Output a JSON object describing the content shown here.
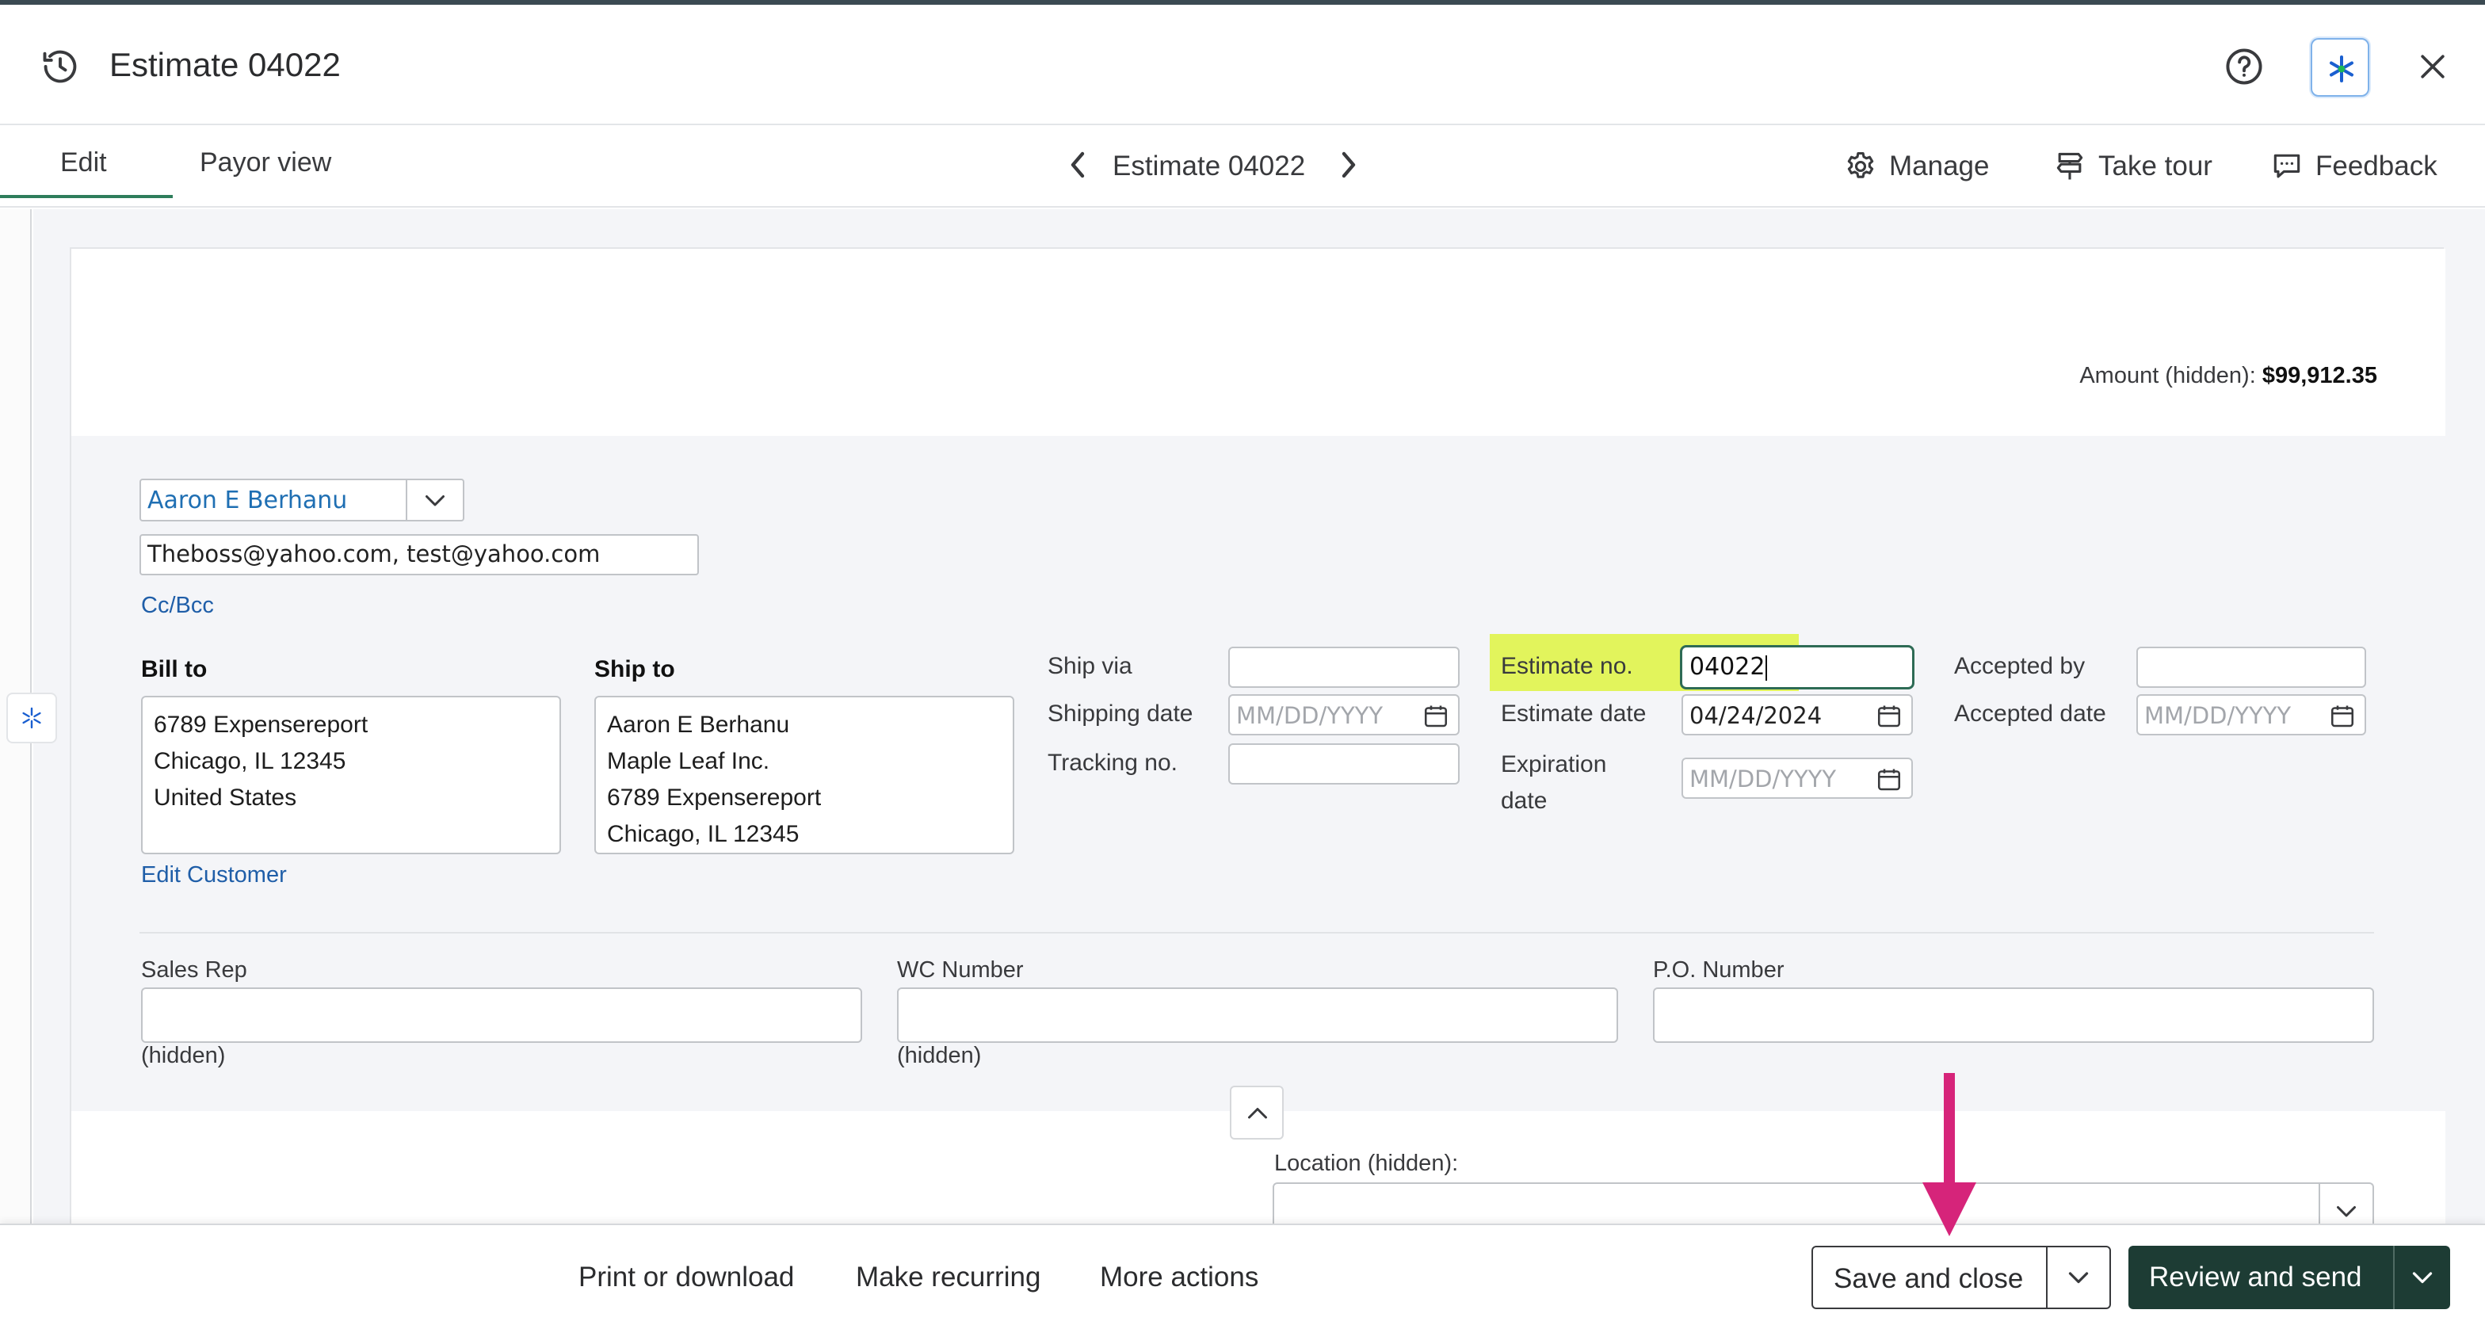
{
  "header": {
    "title": "Estimate 04022",
    "history_icon": "history-icon",
    "help_icon": "help-icon",
    "ai_icon": "sparkle-icon",
    "close_icon": "close-icon"
  },
  "tabs": [
    {
      "label": "Edit",
      "active": true
    },
    {
      "label": "Payor view",
      "active": false
    }
  ],
  "navigator": {
    "title": "Estimate 04022"
  },
  "tools": {
    "manage": "Manage",
    "take_tour": "Take tour",
    "feedback": "Feedback"
  },
  "amount": {
    "label": "Amount (hidden):",
    "value": "$99,912.35"
  },
  "customer": {
    "name": "Aaron E Berhanu",
    "emails": "Theboss@yahoo.com, test@yahoo.com",
    "cc_bcc": "Cc/Bcc"
  },
  "bill_to": {
    "label": "Bill to",
    "lines": [
      "6789 Expensereport",
      "Chicago, IL  12345",
      "United States"
    ]
  },
  "ship_to": {
    "label": "Ship to",
    "lines": [
      "Aaron E Berhanu",
      "Maple Leaf Inc.",
      "6789 Expensereport",
      "Chicago, IL  12345"
    ]
  },
  "edit_customer": "Edit Customer",
  "shipping": {
    "ship_via_label": "Ship via",
    "ship_via_value": "",
    "shipping_date_label": "Shipping date",
    "shipping_date_placeholder": "MM/DD/YYYY",
    "tracking_label": "Tracking no.",
    "tracking_value": ""
  },
  "estimate": {
    "no_label": "Estimate no.",
    "no_value": "04022",
    "date_label": "Estimate date",
    "date_value": "04/24/2024",
    "expiration_label_1": "Expiration",
    "expiration_label_2": "date",
    "expiration_placeholder": "MM/DD/YYYY"
  },
  "acceptance": {
    "accepted_by_label": "Accepted by",
    "accepted_by_value": "",
    "accepted_date_label": "Accepted date",
    "accepted_date_placeholder": "MM/DD/YYYY"
  },
  "custom_fields": [
    {
      "label": "Sales Rep",
      "note": "(hidden)"
    },
    {
      "label": "WC Number",
      "note": "(hidden)"
    },
    {
      "label": "P.O. Number",
      "note": ""
    }
  ],
  "location": {
    "label": "Location (hidden):"
  },
  "footer": {
    "print": "Print or download",
    "recurring": "Make recurring",
    "more": "More actions",
    "save": "Save and close",
    "send": "Review and send"
  },
  "colors": {
    "highlight": "#e2f45c",
    "primary_button": "#1d3c34",
    "link": "#1f5ea8",
    "annotation_arrow": "#d6247a"
  }
}
